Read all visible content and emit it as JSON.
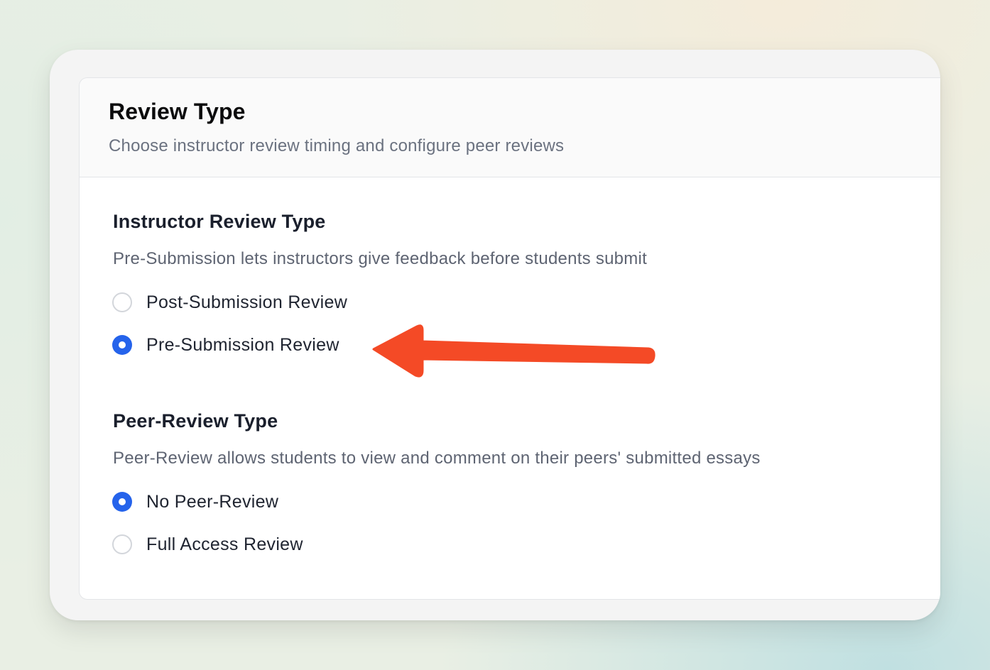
{
  "card": {
    "title": "Review Type",
    "subtitle": "Choose instructor review timing and configure peer reviews"
  },
  "instructor_section": {
    "title": "Instructor Review Type",
    "description": "Pre-Submission lets instructors give feedback before students submit",
    "options": [
      {
        "label": "Post-Submission Review",
        "selected": false
      },
      {
        "label": "Pre-Submission Review",
        "selected": true
      }
    ]
  },
  "peer_section": {
    "title": "Peer-Review Type",
    "description": "Peer-Review allows students to view and comment on their peers' submitted essays",
    "options": [
      {
        "label": "No Peer-Review",
        "selected": true
      },
      {
        "label": "Full Access Review",
        "selected": false
      }
    ]
  },
  "annotation": {
    "arrow_color": "#f44a26",
    "points_to": "Pre-Submission Review"
  },
  "colors": {
    "radio_selected": "#2563eb",
    "radio_unselected_border": "#d3d6db"
  }
}
